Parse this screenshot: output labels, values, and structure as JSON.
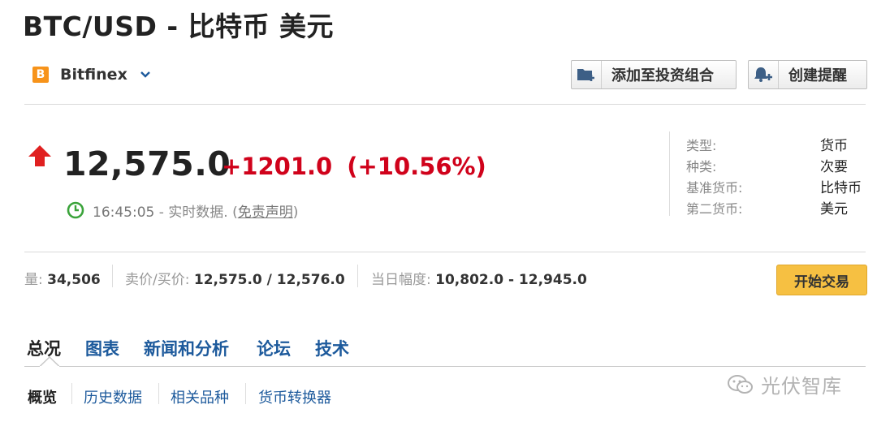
{
  "header": {
    "title": "BTC/USD - 比特币 美元"
  },
  "exchange": {
    "name": "Bitfinex",
    "logo_letter": "B",
    "logo_color": "#f7931a"
  },
  "actions": {
    "portfolio_label": "添加至投资组合",
    "alert_label": "创建提醒"
  },
  "quote": {
    "price": "12,575.0",
    "change": "+1201.0",
    "change_pct": "(+10.56%)",
    "direction": "up",
    "time": "16:45:05",
    "realtime_text": "- 实时数据. (",
    "disclaimer": "免责声明",
    "close_paren": ")",
    "up_color": "#d0021b"
  },
  "info": [
    {
      "label": "类型:",
      "value": "货币"
    },
    {
      "label": "种类:",
      "value": "次要"
    },
    {
      "label": "基准货币:",
      "value": "比特币"
    },
    {
      "label": "第二货币:",
      "value": "美元"
    }
  ],
  "stats": {
    "volume_label": "量:",
    "volume": "34,506",
    "bidask_label": "卖价/买价:",
    "bidask": "12,575.0 / 12,576.0",
    "range_label": "当日幅度:",
    "range": "10,802.0 - 12,945.0"
  },
  "trade_button": "开始交易",
  "tabs": [
    "总况",
    "图表",
    "新闻和分析",
    "论坛",
    "技术"
  ],
  "subtabs": [
    "概览",
    "历史数据",
    "相关品种",
    "货币转换器"
  ],
  "watermark": "光伏智库"
}
